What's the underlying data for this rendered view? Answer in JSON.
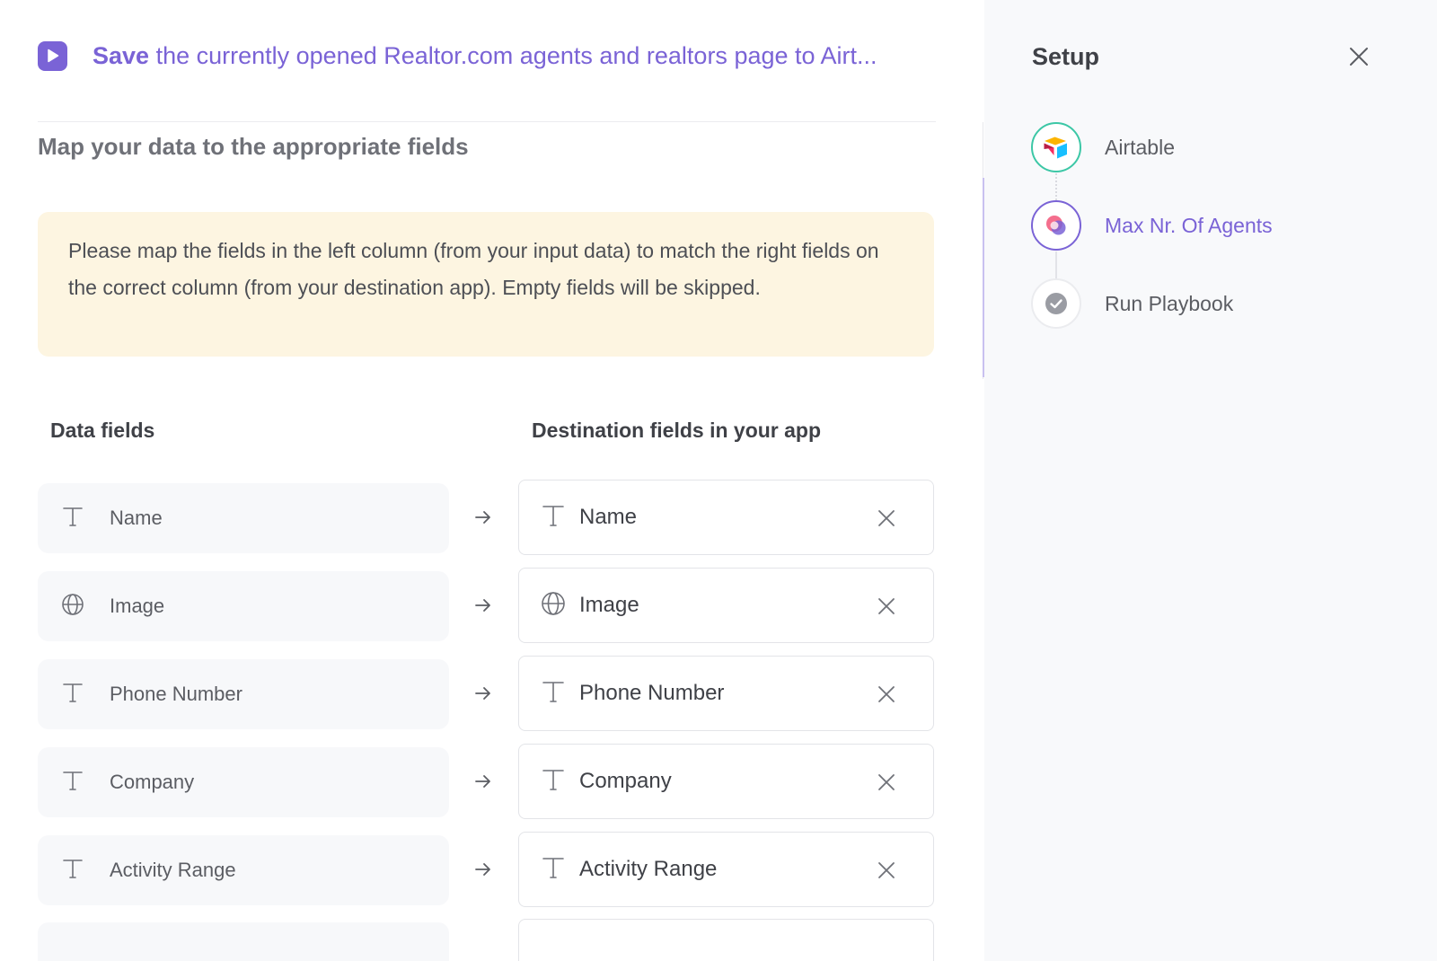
{
  "header": {
    "action_bold": "Save",
    "action_rest": " the currently opened Realtor.com agents and realtors page to Airt...",
    "accent_color": "#7a63d6",
    "icon": "play-icon"
  },
  "mapping": {
    "title": "Map your data to the appropriate fields",
    "notice": "Please map the fields in the left column (from your input data) to match the right fields on the correct column (from your destination app). Empty fields will be skipped.",
    "notice_color": "#fdf5e1",
    "columns": {
      "data_fields": "Data fields",
      "destination_fields": "Destination fields in your app"
    },
    "rows": [
      {
        "source": "Name",
        "destination": "Name",
        "icon": "text-type-icon"
      },
      {
        "source": "Image",
        "destination": "Image",
        "icon": "globe-icon"
      },
      {
        "source": "Phone Number",
        "destination": "Phone Number",
        "icon": "text-type-icon"
      },
      {
        "source": "Company",
        "destination": "Company",
        "icon": "text-type-icon"
      },
      {
        "source": "Activity Range",
        "destination": "Activity Range",
        "icon": "text-type-icon"
      }
    ]
  },
  "setup": {
    "title": "Setup",
    "close_icon": "close-icon",
    "steps": [
      {
        "label": "Airtable",
        "icon": "airtable-logo-icon",
        "state": "done"
      },
      {
        "label": "Max Nr. Of Agents",
        "icon": "agents-icon",
        "state": "active"
      },
      {
        "label": "Run Playbook",
        "icon": "check-circle-icon",
        "state": "pending"
      }
    ]
  }
}
